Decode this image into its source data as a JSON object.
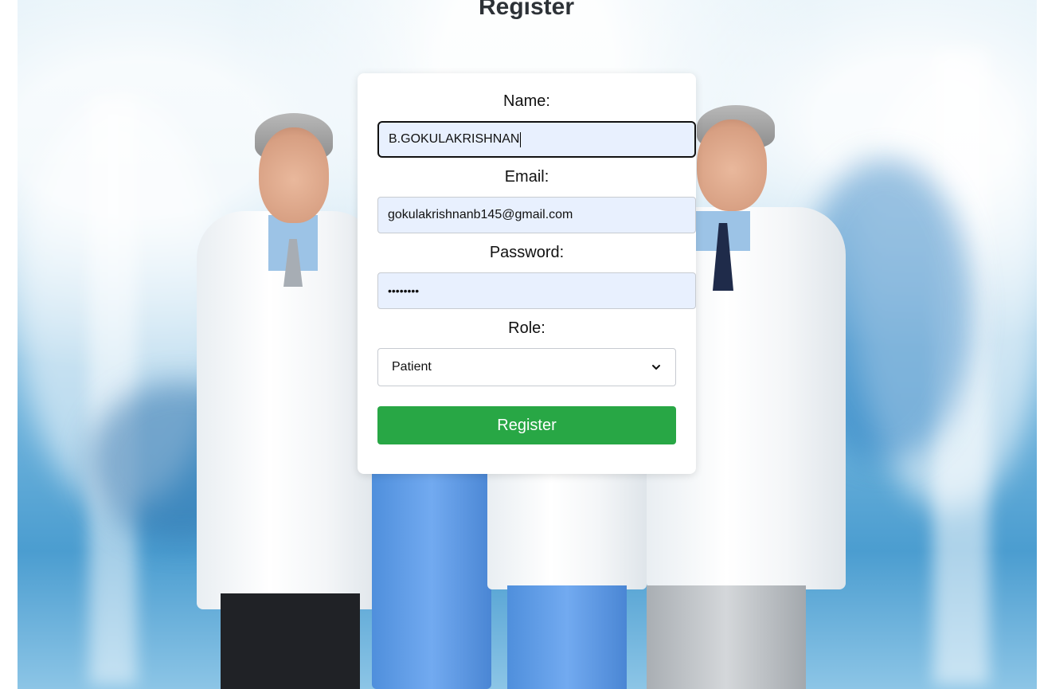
{
  "page": {
    "title": "Register"
  },
  "form": {
    "name_label": "Name:",
    "name_value": "B.GOKULAKRISHNAN",
    "email_label": "Email:",
    "email_value": "gokulakrishnanb145@gmail.com",
    "password_label": "Password:",
    "password_value": "••••••••",
    "role_label": "Role:",
    "role_selected": "Patient",
    "submit_label": "Register"
  },
  "colors": {
    "submit_button": "#28a745",
    "autofill_field": "#e8f0fe",
    "title_text": "#2d3237"
  },
  "icons": {
    "role_dropdown": "chevron-down-icon"
  }
}
